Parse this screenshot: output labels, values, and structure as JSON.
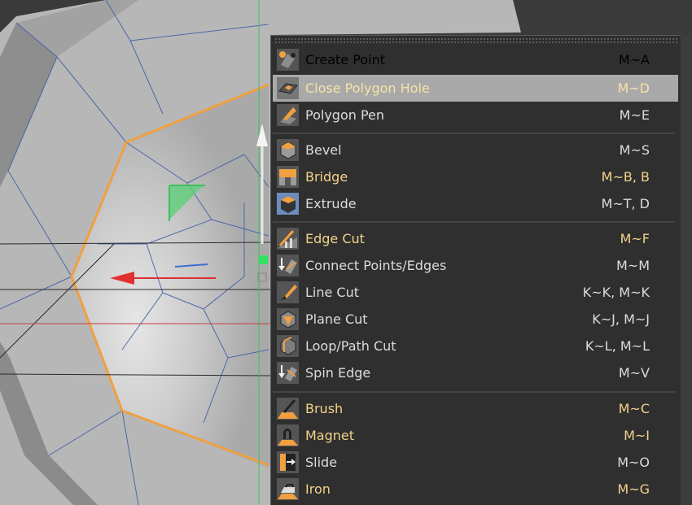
{
  "menu": {
    "items": [
      {
        "label": "Create Point",
        "shortcut": "M~A",
        "icon": "create-point-icon",
        "style": "yellow"
      },
      {
        "label": "Close Polygon Hole",
        "shortcut": "M~D",
        "icon": "close-polygon-hole-icon",
        "style": "highlighted"
      },
      {
        "label": "Polygon Pen",
        "shortcut": "M~E",
        "icon": "polygon-pen-icon",
        "style": "white"
      },
      {
        "label": "Bevel",
        "shortcut": "M~S",
        "icon": "bevel-icon",
        "style": "white"
      },
      {
        "label": "Bridge",
        "shortcut": "M~B, B",
        "icon": "bridge-icon",
        "style": "yellow"
      },
      {
        "label": "Extrude",
        "shortcut": "M~T, D",
        "icon": "extrude-icon",
        "style": "white"
      },
      {
        "label": "Edge Cut",
        "shortcut": "M~F",
        "icon": "edge-cut-icon",
        "style": "yellow"
      },
      {
        "label": "Connect Points/Edges",
        "shortcut": "M~M",
        "icon": "connect-points-edges-icon",
        "style": "white"
      },
      {
        "label": "Line Cut",
        "shortcut": "K~K, M~K",
        "icon": "line-cut-icon",
        "style": "white"
      },
      {
        "label": "Plane Cut",
        "shortcut": "K~J, M~J",
        "icon": "plane-cut-icon",
        "style": "white"
      },
      {
        "label": "Loop/Path Cut",
        "shortcut": "K~L, M~L",
        "icon": "loop-path-cut-icon",
        "style": "white"
      },
      {
        "label": "Spin Edge",
        "shortcut": "M~V",
        "icon": "spin-edge-icon",
        "style": "white"
      },
      {
        "label": "Brush",
        "shortcut": "M~C",
        "icon": "brush-icon",
        "style": "yellow"
      },
      {
        "label": "Magnet",
        "shortcut": "M~I",
        "icon": "magnet-icon",
        "style": "yellow"
      },
      {
        "label": "Slide",
        "shortcut": "M~O",
        "icon": "slide-icon",
        "style": "white"
      },
      {
        "label": "Iron",
        "shortcut": "M~G",
        "icon": "iron-icon",
        "style": "yellow"
      }
    ]
  },
  "colors": {
    "menu_bg": "#2f2f2f",
    "highlight": "#a9a9a9",
    "label_yellow": "#f2d38a",
    "label_white": "#dcdcdc",
    "selection_orange": "#f0a040",
    "axis_y_green": "#3cc060",
    "axis_x_red": "#e03030"
  }
}
